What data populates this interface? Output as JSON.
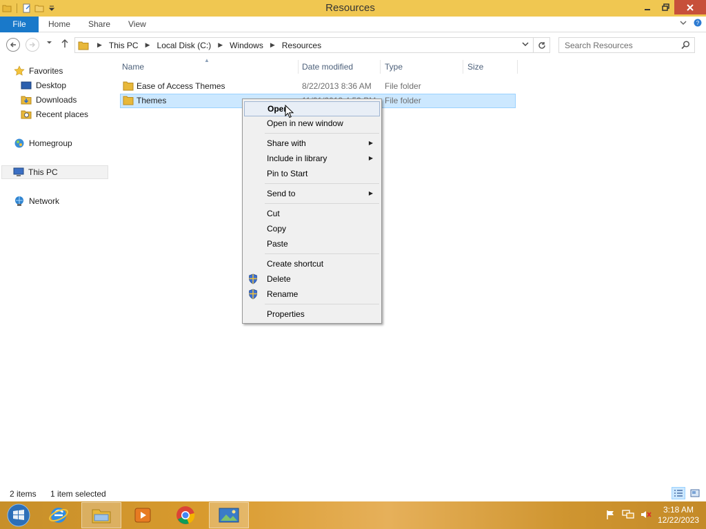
{
  "window": {
    "title": "Resources"
  },
  "ribbon": {
    "file": "File",
    "home": "Home",
    "share": "Share",
    "view": "View"
  },
  "address": {
    "crumbs": [
      "This PC",
      "Local Disk (C:)",
      "Windows",
      "Resources"
    ],
    "search_placeholder": "Search Resources"
  },
  "sidebar": {
    "favorites": "Favorites",
    "desktop": "Desktop",
    "downloads": "Downloads",
    "recent": "Recent places",
    "homegroup": "Homegroup",
    "thispc": "This PC",
    "network": "Network"
  },
  "columns": {
    "name": "Name",
    "date": "Date modified",
    "type": "Type",
    "size": "Size"
  },
  "files": [
    {
      "name": "Ease of Access Themes",
      "date": "8/22/2013 8:36 AM",
      "type": "File folder"
    },
    {
      "name": "Themes",
      "date": "11/21/2013 4:53 PM",
      "type": "File folder"
    }
  ],
  "context_menu": {
    "open": "Open",
    "open_new_window": "Open in new window",
    "share_with": "Share with",
    "include_in_library": "Include in library",
    "pin_to_start": "Pin to Start",
    "send_to": "Send to",
    "cut": "Cut",
    "copy": "Copy",
    "paste": "Paste",
    "create_shortcut": "Create shortcut",
    "delete": "Delete",
    "rename": "Rename",
    "properties": "Properties"
  },
  "status": {
    "items": "2 items",
    "selected": "1 item selected"
  },
  "taskbar": {
    "time": "3:18 AM",
    "date": "12/22/2023"
  },
  "colors": {
    "titlebar": "#f0c751",
    "file_tab": "#1979ca",
    "selection": "#cce8ff",
    "close_button": "#c7503a"
  }
}
